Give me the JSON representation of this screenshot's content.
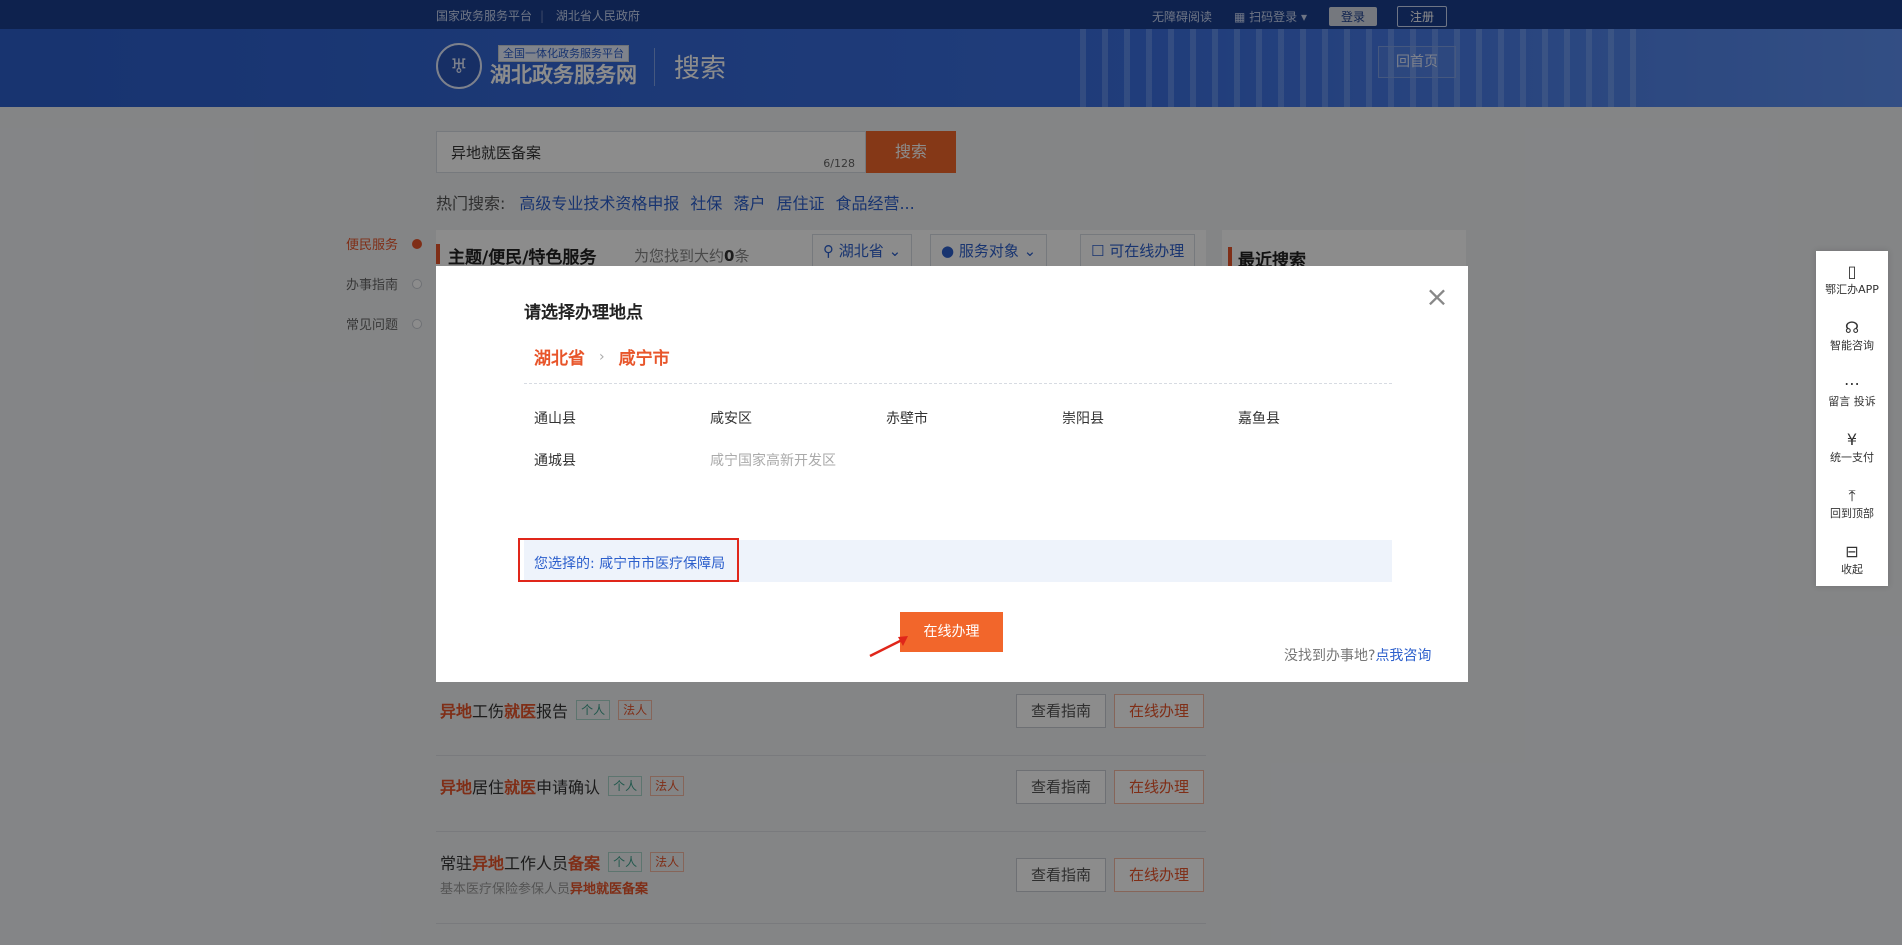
{
  "topbar": {
    "links": [
      "国家政务服务平台",
      "湖北省人民政府"
    ],
    "accessible": "无障碍阅读",
    "scan_login": "扫码登录",
    "login": "登录",
    "register": "注册"
  },
  "header": {
    "logo_tag": "全国一体化政务服务平台",
    "logo_name": "湖北政务服务网",
    "page_title": "搜索",
    "home_button": "回首页"
  },
  "search": {
    "value": "异地就医备案",
    "count": "6/128",
    "button": "搜索"
  },
  "hot": {
    "label": "热门搜索:",
    "items": [
      "高级专业技术资格申报",
      "社保",
      "落户",
      "居住证",
      "食品经营..."
    ]
  },
  "leftnav": [
    "便民服务",
    "办事指南",
    "常见问题"
  ],
  "main": {
    "title": "主题/便民/特色服务",
    "found_prefix": "为您找到大约",
    "found_count": "0",
    "found_suffix": "条",
    "filter_region": "湖北省",
    "filter_target": "服务对象",
    "filter_online": "可在线办理",
    "recent_search": "最近搜索"
  },
  "list": [
    {
      "parts": [
        [
          "异地",
          true
        ],
        [
          "工伤",
          false
        ],
        [
          "就医",
          true
        ],
        [
          "报告",
          false
        ]
      ],
      "tags": [
        "个人",
        "法人"
      ],
      "sub": null,
      "guide": "查看指南",
      "online": "在线办理"
    },
    {
      "parts": [
        [
          "异地",
          true
        ],
        [
          "居住",
          false
        ],
        [
          "就医",
          true
        ],
        [
          "申请确认",
          false
        ]
      ],
      "tags": [
        "个人",
        "法人"
      ],
      "sub": null,
      "guide": "查看指南",
      "online": "在线办理"
    },
    {
      "parts": [
        [
          "常驻",
          false
        ],
        [
          "异地",
          true
        ],
        [
          "工作人员",
          false
        ],
        [
          "备案",
          true
        ]
      ],
      "tags": [
        "个人",
        "法人"
      ],
      "sub": [
        [
          "基本医疗保险参保人员",
          false
        ],
        [
          "异地就医备案",
          true
        ]
      ],
      "guide": "查看指南",
      "online": "在线办理"
    }
  ],
  "floatbar": [
    {
      "icon": "phone-icon",
      "glyph": "▯",
      "label": "鄂汇办APP"
    },
    {
      "icon": "headset-icon",
      "glyph": "☊",
      "label": "智能咨询"
    },
    {
      "icon": "message-icon",
      "glyph": "⋯",
      "label": "留言 投诉"
    },
    {
      "icon": "yen-icon",
      "glyph": "¥",
      "label": "统一支付"
    },
    {
      "icon": "top-icon",
      "glyph": "⤒",
      "label": "回到顶部"
    },
    {
      "icon": "collapse-icon",
      "glyph": "⊟",
      "label": "收起"
    }
  ],
  "modal": {
    "title": "请选择办理地点",
    "crumb1": "湖北省",
    "crumb2": "咸宁市",
    "regions": [
      "通山县",
      "咸安区",
      "赤壁市",
      "崇阳县",
      "嘉鱼县",
      "通城县",
      "咸宁国家高新开发区"
    ],
    "selected_label": "您选择的:",
    "selected_value": "咸宁市市医疗保障局",
    "go_button": "在线办理",
    "notfound_text": "没找到办事地?",
    "notfound_link": "点我咨询"
  }
}
